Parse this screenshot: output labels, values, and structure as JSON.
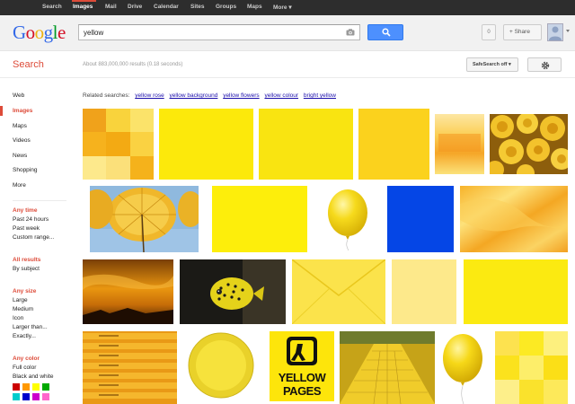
{
  "topnav": {
    "items": [
      "Search",
      "Images",
      "Mail",
      "Drive",
      "Calendar",
      "Sites",
      "Groups",
      "Maps",
      "More ▾"
    ],
    "active_index": 1
  },
  "header": {
    "logo": [
      "G",
      "o",
      "o",
      "g",
      "l",
      "e"
    ],
    "logo_colors": [
      "#3369e8",
      "#d50f25",
      "#eeb211",
      "#3369e8",
      "#009925",
      "#d50f25"
    ],
    "query": "yellow",
    "notifications_count": "0",
    "share_label": "+ Share"
  },
  "subhead": {
    "search_label": "Search",
    "result_stats": "About 883,000,000 results (0.18 seconds)",
    "safesearch_label": "SafeSearch off ▾"
  },
  "sidebar": {
    "items": [
      "Web",
      "Images",
      "Maps",
      "Videos",
      "News",
      "Shopping",
      "More"
    ],
    "active_index": 1,
    "time_heading": "Any time",
    "time_options": [
      "Past 24 hours",
      "Past week",
      "Custom range..."
    ],
    "results_heading": "All results",
    "results_options": [
      "By subject"
    ],
    "size_heading": "Any size",
    "size_options": [
      "Large",
      "Medium",
      "Icon",
      "Larger than...",
      "Exactly..."
    ],
    "color_heading": "Any color",
    "color_options": [
      "Full color",
      "Black and white"
    ],
    "swatches": [
      "#cc0000",
      "#ff9900",
      "#ffff00",
      "#00aa00",
      "#00cccc",
      "#0000cc",
      "#cc00cc",
      "#ff66cc"
    ]
  },
  "related": {
    "label": "Related searches:",
    "links": [
      "yellow rose",
      "yellow background",
      "yellow flowers",
      "yellow colour",
      "bright yellow"
    ]
  },
  "yellow_pages": {
    "line1": "YELLOW",
    "line2": "PAGES"
  },
  "colors": {
    "accent_red": "#dd4b39",
    "search_blue": "#4d90fe",
    "link_blue": "#1a0dab"
  }
}
